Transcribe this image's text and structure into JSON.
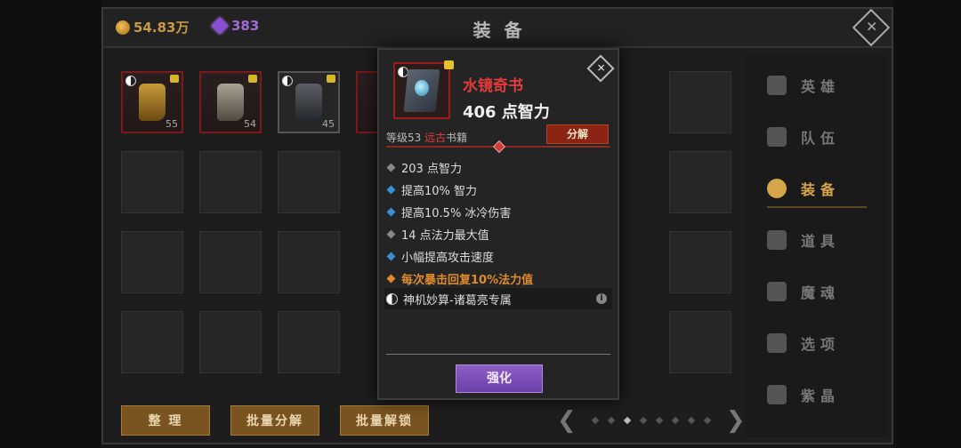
{
  "header": {
    "gold": "54.83万",
    "gems": "383",
    "title": "装 备"
  },
  "inventory": {
    "items": [
      {
        "level": "55"
      },
      {
        "level": "54"
      },
      {
        "level": "45"
      }
    ]
  },
  "bottom_buttons": {
    "sort": "整 理",
    "batch_decompose": "批量分解",
    "batch_unlock": "批量解锁"
  },
  "pager": {
    "prev": "❮",
    "next": "❯",
    "current_page": 3
  },
  "side_menu": {
    "items": [
      {
        "label": "英雄"
      },
      {
        "label": "队伍"
      },
      {
        "label": "装备"
      },
      {
        "label": "道具"
      },
      {
        "label": "魔魂"
      },
      {
        "label": "选项"
      },
      {
        "label": "紫晶"
      }
    ]
  },
  "item_popup": {
    "name": "水镜奇书",
    "main_stat": "406 点智力",
    "level_prefix": "等级53 ",
    "quality": "远古",
    "category": "书籍",
    "decompose_label": "分解",
    "stats": [
      {
        "text": "203 点智力"
      },
      {
        "text": "提高10% 智力"
      },
      {
        "text": "提高10.5% 冰冷伤害"
      },
      {
        "text": "14 点法力最大值"
      },
      {
        "text": "小幅提高攻击速度"
      },
      {
        "text": "每次暴击回复10%法力值"
      }
    ],
    "set_text": "神机妙算-诸葛亮专属",
    "strengthen_label": "强化"
  },
  "colors": {
    "gold": "#c89a44",
    "gem": "#a26ad8",
    "item_name": "#e33b3b",
    "bullet_gray": "#888888",
    "bullet_blue": "#3a8fd8",
    "bullet_orange": "#e08a2e",
    "strengthen": "#7a4cb8"
  }
}
